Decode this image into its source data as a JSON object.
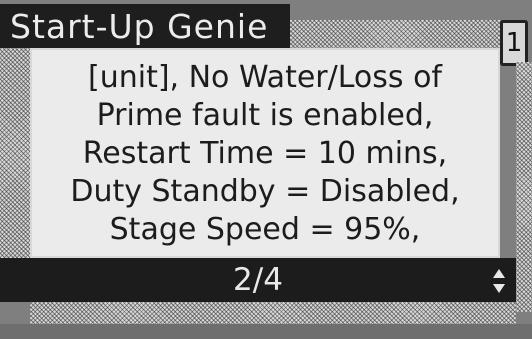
{
  "header": {
    "title": "Start-Up Genie",
    "page_indicator": "1"
  },
  "message": {
    "lines": [
      "[unit], No Water/Loss of",
      "Prime fault is enabled,",
      "Restart Time = 10 mins,",
      "Duty Standby = Disabled,",
      "Stage Speed = 95%,"
    ]
  },
  "pager": {
    "label": "2/4",
    "icon": "up-down-arrows-icon"
  },
  "colors": {
    "screen_bg": "#7f7f7f",
    "bar_dark": "#1c1c1c",
    "text_light": "#e8e8e8",
    "panel_light": "#ebebeb"
  }
}
